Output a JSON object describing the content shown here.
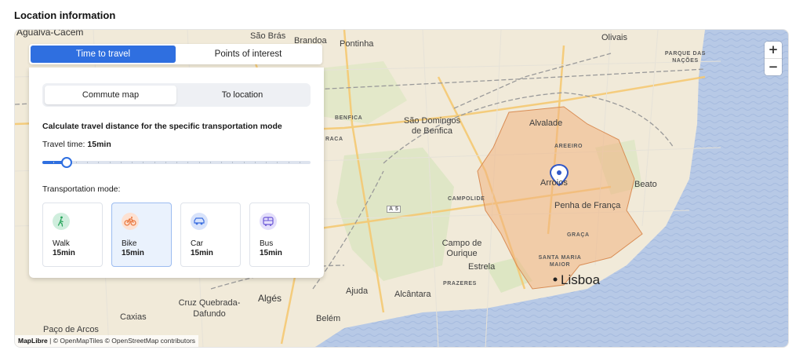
{
  "section_title": "Location information",
  "tabs": [
    {
      "label": "Time to travel",
      "active": true
    },
    {
      "label": "Points of interest",
      "active": false
    }
  ],
  "segment": [
    {
      "label": "Commute map",
      "active": true
    },
    {
      "label": "To location",
      "active": false
    }
  ],
  "description": "Calculate travel distance for the specific transportation mode",
  "travel_time": {
    "label": "Travel time:",
    "value": "15min",
    "slider_fraction": 0.09
  },
  "transport_label": "Transportation mode:",
  "modes": [
    {
      "name": "Walk",
      "time": "15min",
      "icon": "walk-icon",
      "color": "#cfeedd",
      "stroke": "#27a35a",
      "active": false
    },
    {
      "name": "Bike",
      "time": "15min",
      "icon": "bike-icon",
      "color": "#fde1d2",
      "stroke": "#e8743b",
      "active": true
    },
    {
      "name": "Car",
      "time": "15min",
      "icon": "car-icon",
      "color": "#d8e3fb",
      "stroke": "#3b6ee0",
      "active": false
    },
    {
      "name": "Bus",
      "time": "15min",
      "icon": "bus-icon",
      "color": "#e3defb",
      "stroke": "#6a56d6",
      "active": false
    }
  ],
  "zoom": {
    "in": "+",
    "out": "−"
  },
  "map_labels": [
    {
      "text": "Agualva-Cacém",
      "cls": "mid"
    },
    {
      "text": "São Brás",
      "cls": ""
    },
    {
      "text": "Brandoa",
      "cls": ""
    },
    {
      "text": "Pontinha",
      "cls": ""
    },
    {
      "text": "Olivais",
      "cls": ""
    },
    {
      "text": "PARQUE DAS NAÇÕES",
      "cls": "small"
    },
    {
      "text": "BENFICA",
      "cls": "small"
    },
    {
      "text": "São Domingos de Benfica",
      "cls": ""
    },
    {
      "text": "Alvalade",
      "cls": ""
    },
    {
      "text": "AREEIRO",
      "cls": "small"
    },
    {
      "text": "Arroios",
      "cls": ""
    },
    {
      "text": "Beato",
      "cls": ""
    },
    {
      "text": "CAMPOLIDE",
      "cls": "small"
    },
    {
      "text": "A 5",
      "cls": "small"
    },
    {
      "text": "Penha de França",
      "cls": ""
    },
    {
      "text": "GRAÇA",
      "cls": "small"
    },
    {
      "text": "Campo de Ourique",
      "cls": ""
    },
    {
      "text": "SANTA MARIA MAIOR",
      "cls": "small"
    },
    {
      "text": "Estrela",
      "cls": ""
    },
    {
      "text": "Lisboa",
      "cls": "city"
    },
    {
      "text": "PRAZERES",
      "cls": "small"
    },
    {
      "text": "Ajuda",
      "cls": ""
    },
    {
      "text": "Alcântara",
      "cls": ""
    },
    {
      "text": "Algés",
      "cls": "mid"
    },
    {
      "text": "Cruz Quebrada-Dafundo",
      "cls": ""
    },
    {
      "text": "Caxias",
      "cls": ""
    },
    {
      "text": "Paço de Arcos",
      "cls": ""
    },
    {
      "text": "Belém",
      "cls": ""
    },
    {
      "text": "RACA",
      "cls": "small"
    }
  ],
  "attribution": {
    "brand": "MapLibre",
    "rest": " | © OpenMapTiles © OpenStreetMap contributors"
  },
  "colors": {
    "accent": "#2f6fe0",
    "isochrone": "#f0b27f",
    "water": "#b7c9e6",
    "land": "#f1ead9",
    "park": "#d9e4c2"
  }
}
